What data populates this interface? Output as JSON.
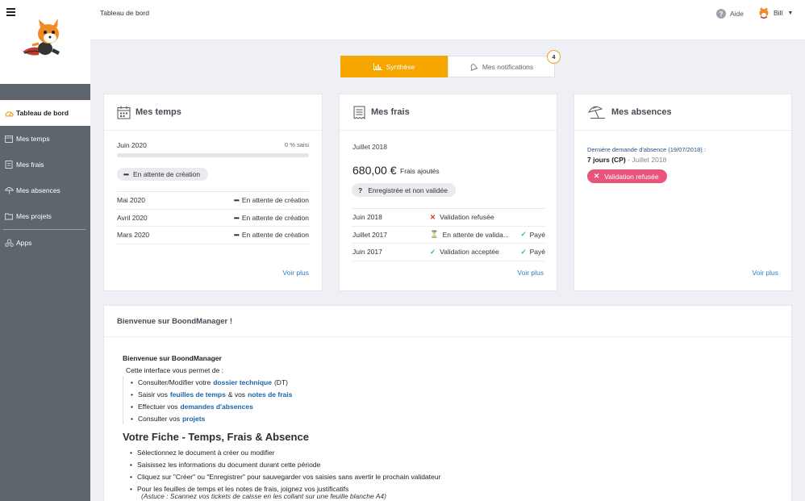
{
  "topbar": {
    "title": "Tableau de bord",
    "help": "Aide",
    "user": "Bill"
  },
  "sidebar": {
    "items": [
      {
        "label": "Tableau de bord",
        "icon": "dashboard-icon",
        "active": true
      },
      {
        "label": "Mes temps",
        "icon": "calendar-icon"
      },
      {
        "label": "Mes frais",
        "icon": "receipt-icon"
      },
      {
        "label": "Mes absences",
        "icon": "umbrella-icon"
      },
      {
        "label": "Mes projets",
        "icon": "folder-icon"
      },
      {
        "label": "Apps",
        "icon": "apps-icon"
      }
    ]
  },
  "tabs": {
    "synthese": "Synthèse",
    "notifications": "Mes notifications",
    "notif_count": "4"
  },
  "temps": {
    "title": "Mes temps",
    "current_month": "Juin 2020",
    "percent": "0 % saisi",
    "progress_fraction": 0,
    "pending_label": "En attente de création",
    "rows": [
      {
        "month": "Mai 2020",
        "status": "En attente de création"
      },
      {
        "month": "Avril 2020",
        "status": "En attente de création"
      },
      {
        "month": "Mars 2020",
        "status": "En attente de création"
      }
    ],
    "more": "Voir plus"
  },
  "frais": {
    "title": "Mes frais",
    "month": "Juillet 2018",
    "amount": "680,00 €",
    "amount_sub": "Frais ajoutés",
    "status_pill": "Enregistrée et non validée",
    "rows": [
      {
        "month": "Juin 2018",
        "status": "Validation refusée",
        "paid": ""
      },
      {
        "month": "Juillet 2017",
        "status": "En attente de valida...",
        "paid": "Payé"
      },
      {
        "month": "Juin 2017",
        "status": "Validation acceptée",
        "paid": "Payé"
      }
    ],
    "more": "Voir plus"
  },
  "absences": {
    "title": "Mes absences",
    "last_request": "Dernière demande d'absence (19/07/2018) :",
    "days": "7 jours (CP)",
    "period": "- Juillet 2018",
    "status": "Validation refusée",
    "more": "Voir plus"
  },
  "welcome": {
    "title": "Bienvenue sur BoondManager !",
    "intro": "Bienvenue sur BoondManager",
    "allows": "Cette interface vous permet de :",
    "list1": [
      {
        "pre": "Consulter/Modifier votre",
        "link": "dossier technique",
        "post": "(DT)"
      },
      {
        "pre": "Saisir vos",
        "link": "feuilles de temps",
        "mid": "& vos",
        "link2": "notes de frais"
      },
      {
        "pre": "Effectuer vos",
        "link": "demandes d'absences"
      },
      {
        "pre": "Consulter vos",
        "link": "projets"
      }
    ],
    "heading": "Votre Fiche - Temps, Frais & Absence",
    "list2": [
      "Sélectionnez le document à créer ou modifier",
      "Saisissez les informations du document durant cette période",
      "Cliquez sur \"Créer\" ou \"Enregistrer\" pour sauvegarder vos saisies sans avertir le prochain validateur",
      "Pour les feuilles de temps et les notes de frais, joignez vos justificatifs"
    ],
    "astuce": "(Astuce : Scannez vos tickets de caisse en les collant sur une feuille blanche A4)"
  },
  "colors": {
    "accent": "#f7a600",
    "sidebar": "#5e656c",
    "link": "#2a7ec1",
    "refused": "#e9557a",
    "ok": "#2bb3a0",
    "error": "#d9342b"
  }
}
